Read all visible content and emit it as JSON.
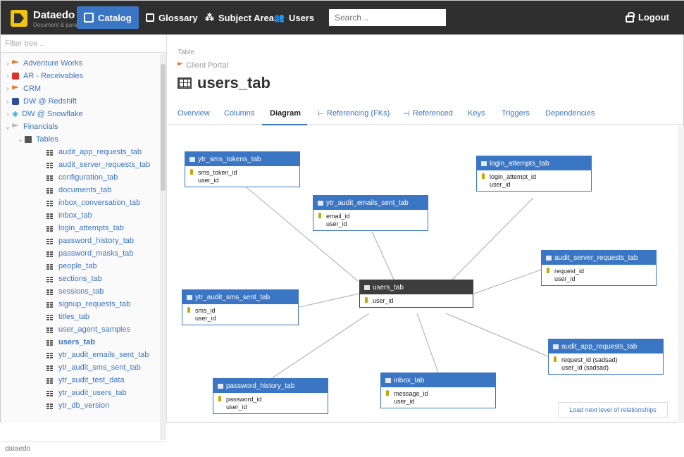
{
  "topbar": {
    "brand": "Dataedo",
    "brand_sub": "Document & paradise",
    "nav": [
      {
        "label": "Catalog",
        "active": true
      },
      {
        "label": "Glossary",
        "active": false
      },
      {
        "label": "Subject Areas",
        "active": false
      },
      {
        "label": "Users",
        "active": false
      }
    ],
    "search_placeholder": "Search ..",
    "logout_label": "Logout"
  },
  "sidebar": {
    "filter_placeholder": "Filter tree ..",
    "databases": [
      {
        "label": "Adventure Works",
        "color": "#e07b39"
      },
      {
        "label": "AR - Receivables",
        "color": "#d9342b"
      },
      {
        "label": "CRM",
        "color": "#e07b39"
      },
      {
        "label": "DW @ Redshift",
        "color": "#2c4e9b"
      },
      {
        "label": "DW @ Snowflake",
        "color": "#29b5e8"
      },
      {
        "label": "Financials",
        "color": "#999999"
      }
    ],
    "folder": "Tables",
    "tables": [
      "audit_app_requests_tab",
      "audit_server_requests_tab",
      "configuration_tab",
      "documents_tab",
      "inbox_conversation_tab",
      "inbox_tab",
      "login_attempts_tab",
      "password_history_tab",
      "password_masks_tab",
      "people_tab",
      "sections_tab",
      "sessions_tab",
      "signup_requests_tab",
      "titles_tab",
      "user_agent_samples",
      "users_tab",
      "ytr_audit_emails_sent_tab",
      "ytr_audit_sms_sent_tab",
      "ytr_audit_test_data",
      "ytr_audit_users_tab",
      "ytr_db_version"
    ],
    "selected": "users_tab",
    "footer": "dataedo"
  },
  "main": {
    "object_type": "Table",
    "module": "Client Portal",
    "title": "users_tab",
    "tabs": [
      "Overview",
      "Columns",
      "Diagram",
      "Referencing (FKs)",
      "Referenced",
      "Keys",
      "Triggers",
      "Dependencies"
    ],
    "active_tab": "Diagram",
    "load_next": "Load next level of relationships"
  },
  "diagram": {
    "entities": [
      {
        "id": "ytr_sms_tokens_tab",
        "title": "ytr_sms_tokens_tab",
        "rows": [
          {
            "name": "sms_token_id",
            "key": true
          },
          {
            "name": "user_id",
            "key": false
          }
        ]
      },
      {
        "id": "ytr_audit_emails_sent_tab",
        "title": "ytr_audit_emails_sent_tab",
        "rows": [
          {
            "name": "email_id",
            "key": true
          },
          {
            "name": "user_id",
            "key": false
          }
        ]
      },
      {
        "id": "login_attempts_tab",
        "title": "login_attempts_tab",
        "rows": [
          {
            "name": "login_attempt_id",
            "key": true
          },
          {
            "name": "user_id",
            "key": false
          }
        ]
      },
      {
        "id": "audit_server_requests_tab",
        "title": "audit_server_requests_tab",
        "rows": [
          {
            "name": "request_id",
            "key": true
          },
          {
            "name": "user_id",
            "key": false
          }
        ]
      },
      {
        "id": "users_tab",
        "title": "users_tab",
        "rows": [
          {
            "name": "user_id",
            "key": true
          }
        ]
      },
      {
        "id": "ytr_audit_sms_sent_tab",
        "title": "ytr_audit_sms_sent_tab",
        "rows": [
          {
            "name": "sms_id",
            "key": true
          },
          {
            "name": "user_id",
            "key": false
          }
        ]
      },
      {
        "id": "audit_app_requests_tab",
        "title": "audit_app_requests_tab",
        "rows": [
          {
            "name": "request_id (sadsad)",
            "key": true
          },
          {
            "name": "user_id (sadsad)",
            "key": false
          }
        ]
      },
      {
        "id": "password_history_tab",
        "title": "password_history_tab",
        "rows": [
          {
            "name": "password_id",
            "key": true
          },
          {
            "name": "user_id",
            "key": false
          }
        ]
      },
      {
        "id": "inbox_tab",
        "title": "inbox_tab",
        "rows": [
          {
            "name": "message_id",
            "key": true
          },
          {
            "name": "user_id",
            "key": false
          }
        ]
      }
    ]
  }
}
